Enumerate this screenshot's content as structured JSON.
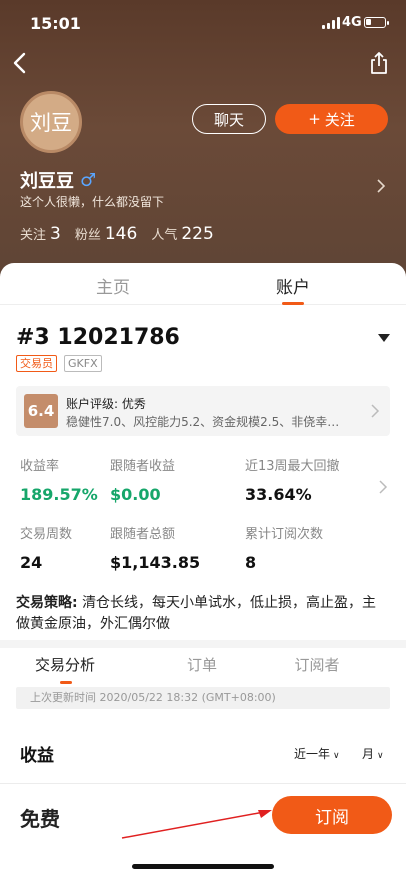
{
  "status_bar": {
    "time": "15:01",
    "network": "4G"
  },
  "profile": {
    "avatar_text": "刘豆",
    "name": "刘豆豆",
    "gender_symbol": "♂",
    "bio": "这个人很懒，什么都没留下",
    "chat_label": "聊天",
    "follow_label": "关注",
    "follow_plus": "+",
    "stats": [
      {
        "label": "关注",
        "value": "3"
      },
      {
        "label": "粉丝",
        "value": "146"
      },
      {
        "label": "人气",
        "value": "225"
      }
    ]
  },
  "tabs": {
    "home": "主页",
    "account": "账户"
  },
  "account": {
    "title": "#3 12021786",
    "tag_role": "交易员",
    "tag_broker": "GKFX",
    "rating": {
      "badge": "6.4",
      "title": "账户评级: 优秀",
      "detail": "稳健性7.0、风控能力5.2、资金规模2.5、非侥幸…"
    },
    "metrics": [
      {
        "label": "收益率",
        "value": "189.57%"
      },
      {
        "label": "跟随者收益",
        "value": "$0.00"
      },
      {
        "label": "近13周最大回撤",
        "value": "33.64%"
      },
      {
        "label": "交易周数",
        "value": "24"
      },
      {
        "label": "跟随者总额",
        "value": "$1,143.85"
      },
      {
        "label": "累计订阅次数",
        "value": "8"
      }
    ],
    "strategy_label": "交易策略:",
    "strategy_text": "清仓长线，每天小单试水，低止损，高止盈，主做黄金原油，外汇偶尔做"
  },
  "subtabs": {
    "analysis": "交易分析",
    "orders": "订单",
    "subscribers": "订阅者"
  },
  "last_update": "上次更新时间 2020/05/22 18:32 (GMT+08:00)",
  "income": {
    "title": "收益",
    "range_period": "近一年",
    "range_unit": "月"
  },
  "bottom": {
    "price": "免费",
    "subscribe": "订阅"
  },
  "colors": {
    "accent": "#f15a17",
    "positive": "#16a66a",
    "header_bg": "#5e4435"
  }
}
